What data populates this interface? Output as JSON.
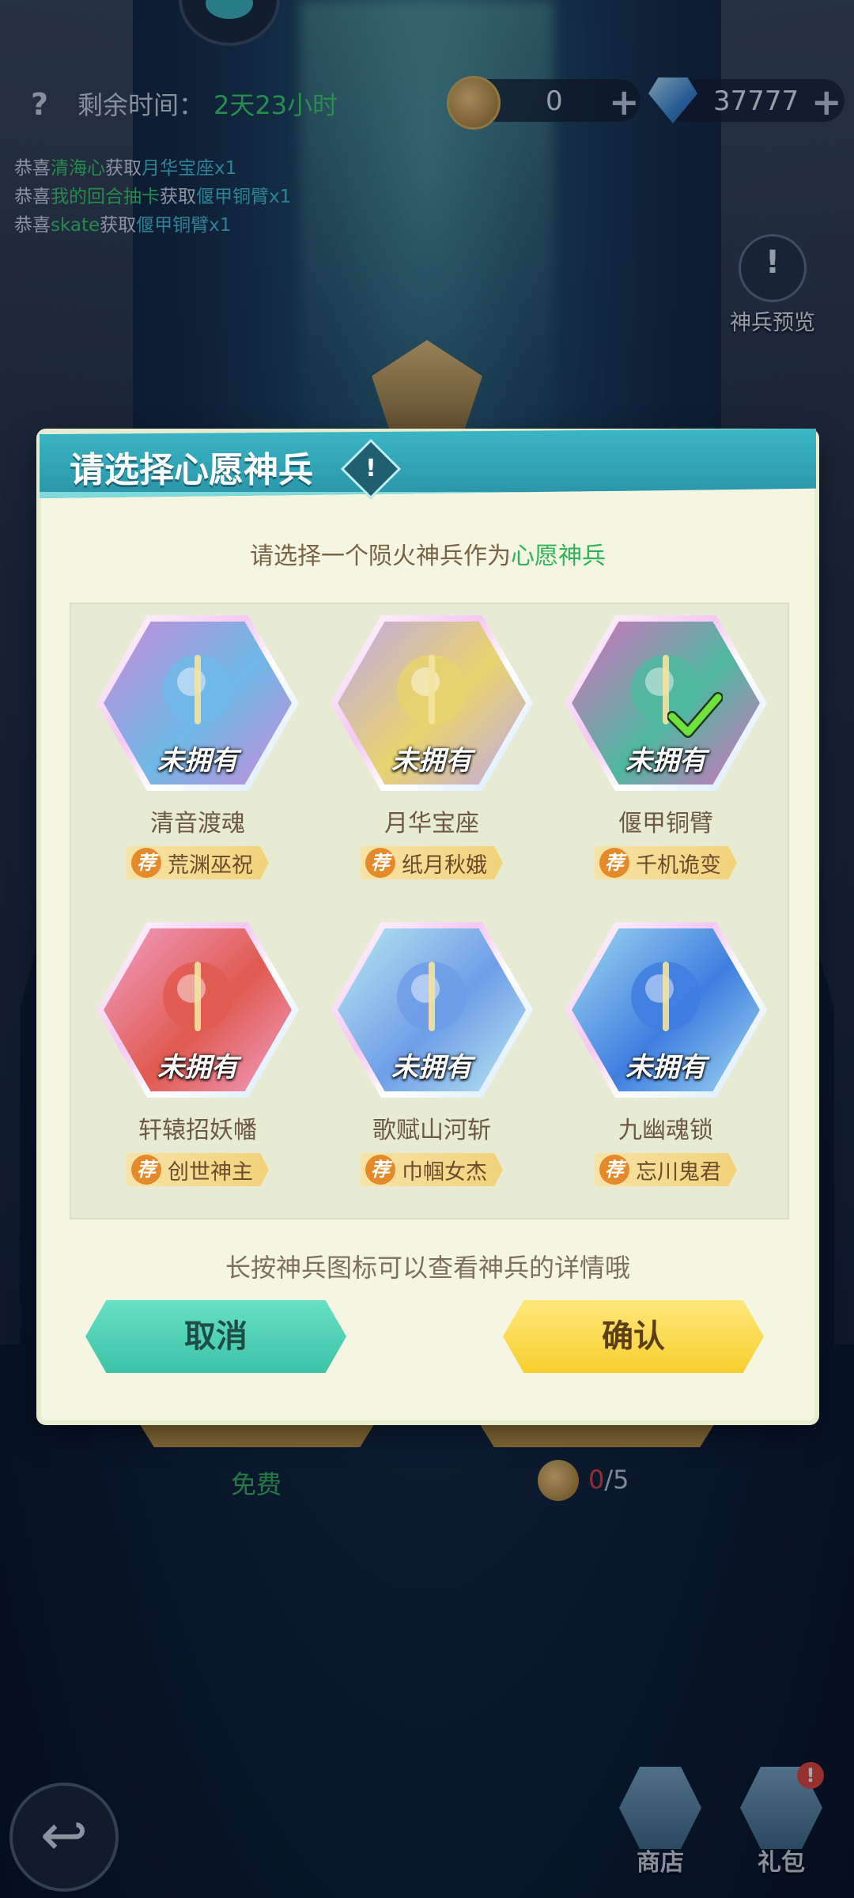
{
  "status_bar": {
    "time_label": "剩余时间：",
    "time_value": "2天23小时",
    "feather_count": "0",
    "gem_count": "37777",
    "plus": "+"
  },
  "help": {
    "glyph": "?"
  },
  "marquee": [
    {
      "prefix": "恭喜",
      "user": "清海心",
      "mid": "获取",
      "reward": "月华宝座x1"
    },
    {
      "prefix": "恭喜",
      "user": "我的回合抽卡",
      "mid": "获取",
      "reward": "偃甲铜臂x1"
    },
    {
      "prefix": "恭喜",
      "user": "skate",
      "mid": "获取",
      "reward": "偃甲铜臂x1"
    }
  ],
  "preview": {
    "label": "神兵预览"
  },
  "dialog": {
    "title": "请选择心愿神兵",
    "info_glyph": "!",
    "subtitle_prefix": "请选择一个陨火神兵作为",
    "subtitle_highlight": "心愿神兵",
    "hint": "长按神兵图标可以查看神兵的详情哦",
    "cancel_label": "取消",
    "confirm_label": "确认",
    "rec_badge": "荐",
    "items": [
      {
        "name": "清音渡魂",
        "status": "未拥有",
        "recommend": "荒渊巫祝",
        "icon": "bell-weapon-icon",
        "colors": [
          "#6fb8e8",
          "#c98bd9"
        ]
      },
      {
        "name": "月华宝座",
        "status": "未拥有",
        "recommend": "纸月秋娥",
        "icon": "moon-throne-icon",
        "colors": [
          "#e8d46f",
          "#c0a8e8"
        ]
      },
      {
        "name": "偃甲铜臂",
        "status": "未拥有",
        "recommend": "千机诡变",
        "icon": "bronze-arm-icon",
        "colors": [
          "#4fb8a0",
          "#d96fbf"
        ]
      },
      {
        "name": "轩辕招妖幡",
        "status": "未拥有",
        "recommend": "创世神主",
        "icon": "banner-weapon-icon",
        "colors": [
          "#e05a4f",
          "#f0a0c8"
        ]
      },
      {
        "name": "歌赋山河斩",
        "status": "未拥有",
        "recommend": "巾帼女杰",
        "icon": "spear-weapon-icon",
        "colors": [
          "#6f9ee8",
          "#b8e8f0"
        ]
      },
      {
        "name": "九幽魂锁",
        "status": "未拥有",
        "recommend": "忘川鬼君",
        "icon": "soul-chain-icon",
        "colors": [
          "#3f7ee0",
          "#a0d8f0"
        ]
      }
    ],
    "selected_index": 2
  },
  "bottom": {
    "free_label": "免费",
    "count_current": "0",
    "count_total": "/5",
    "shop_label": "商店",
    "gift_label": "礼包",
    "gift_badge": "!"
  },
  "colors": {
    "accent_green": "#38d06a",
    "dialog_header": "#3bb7c4",
    "confirm_button": "#f7cf2e",
    "cancel_button": "#3cc3a7"
  }
}
